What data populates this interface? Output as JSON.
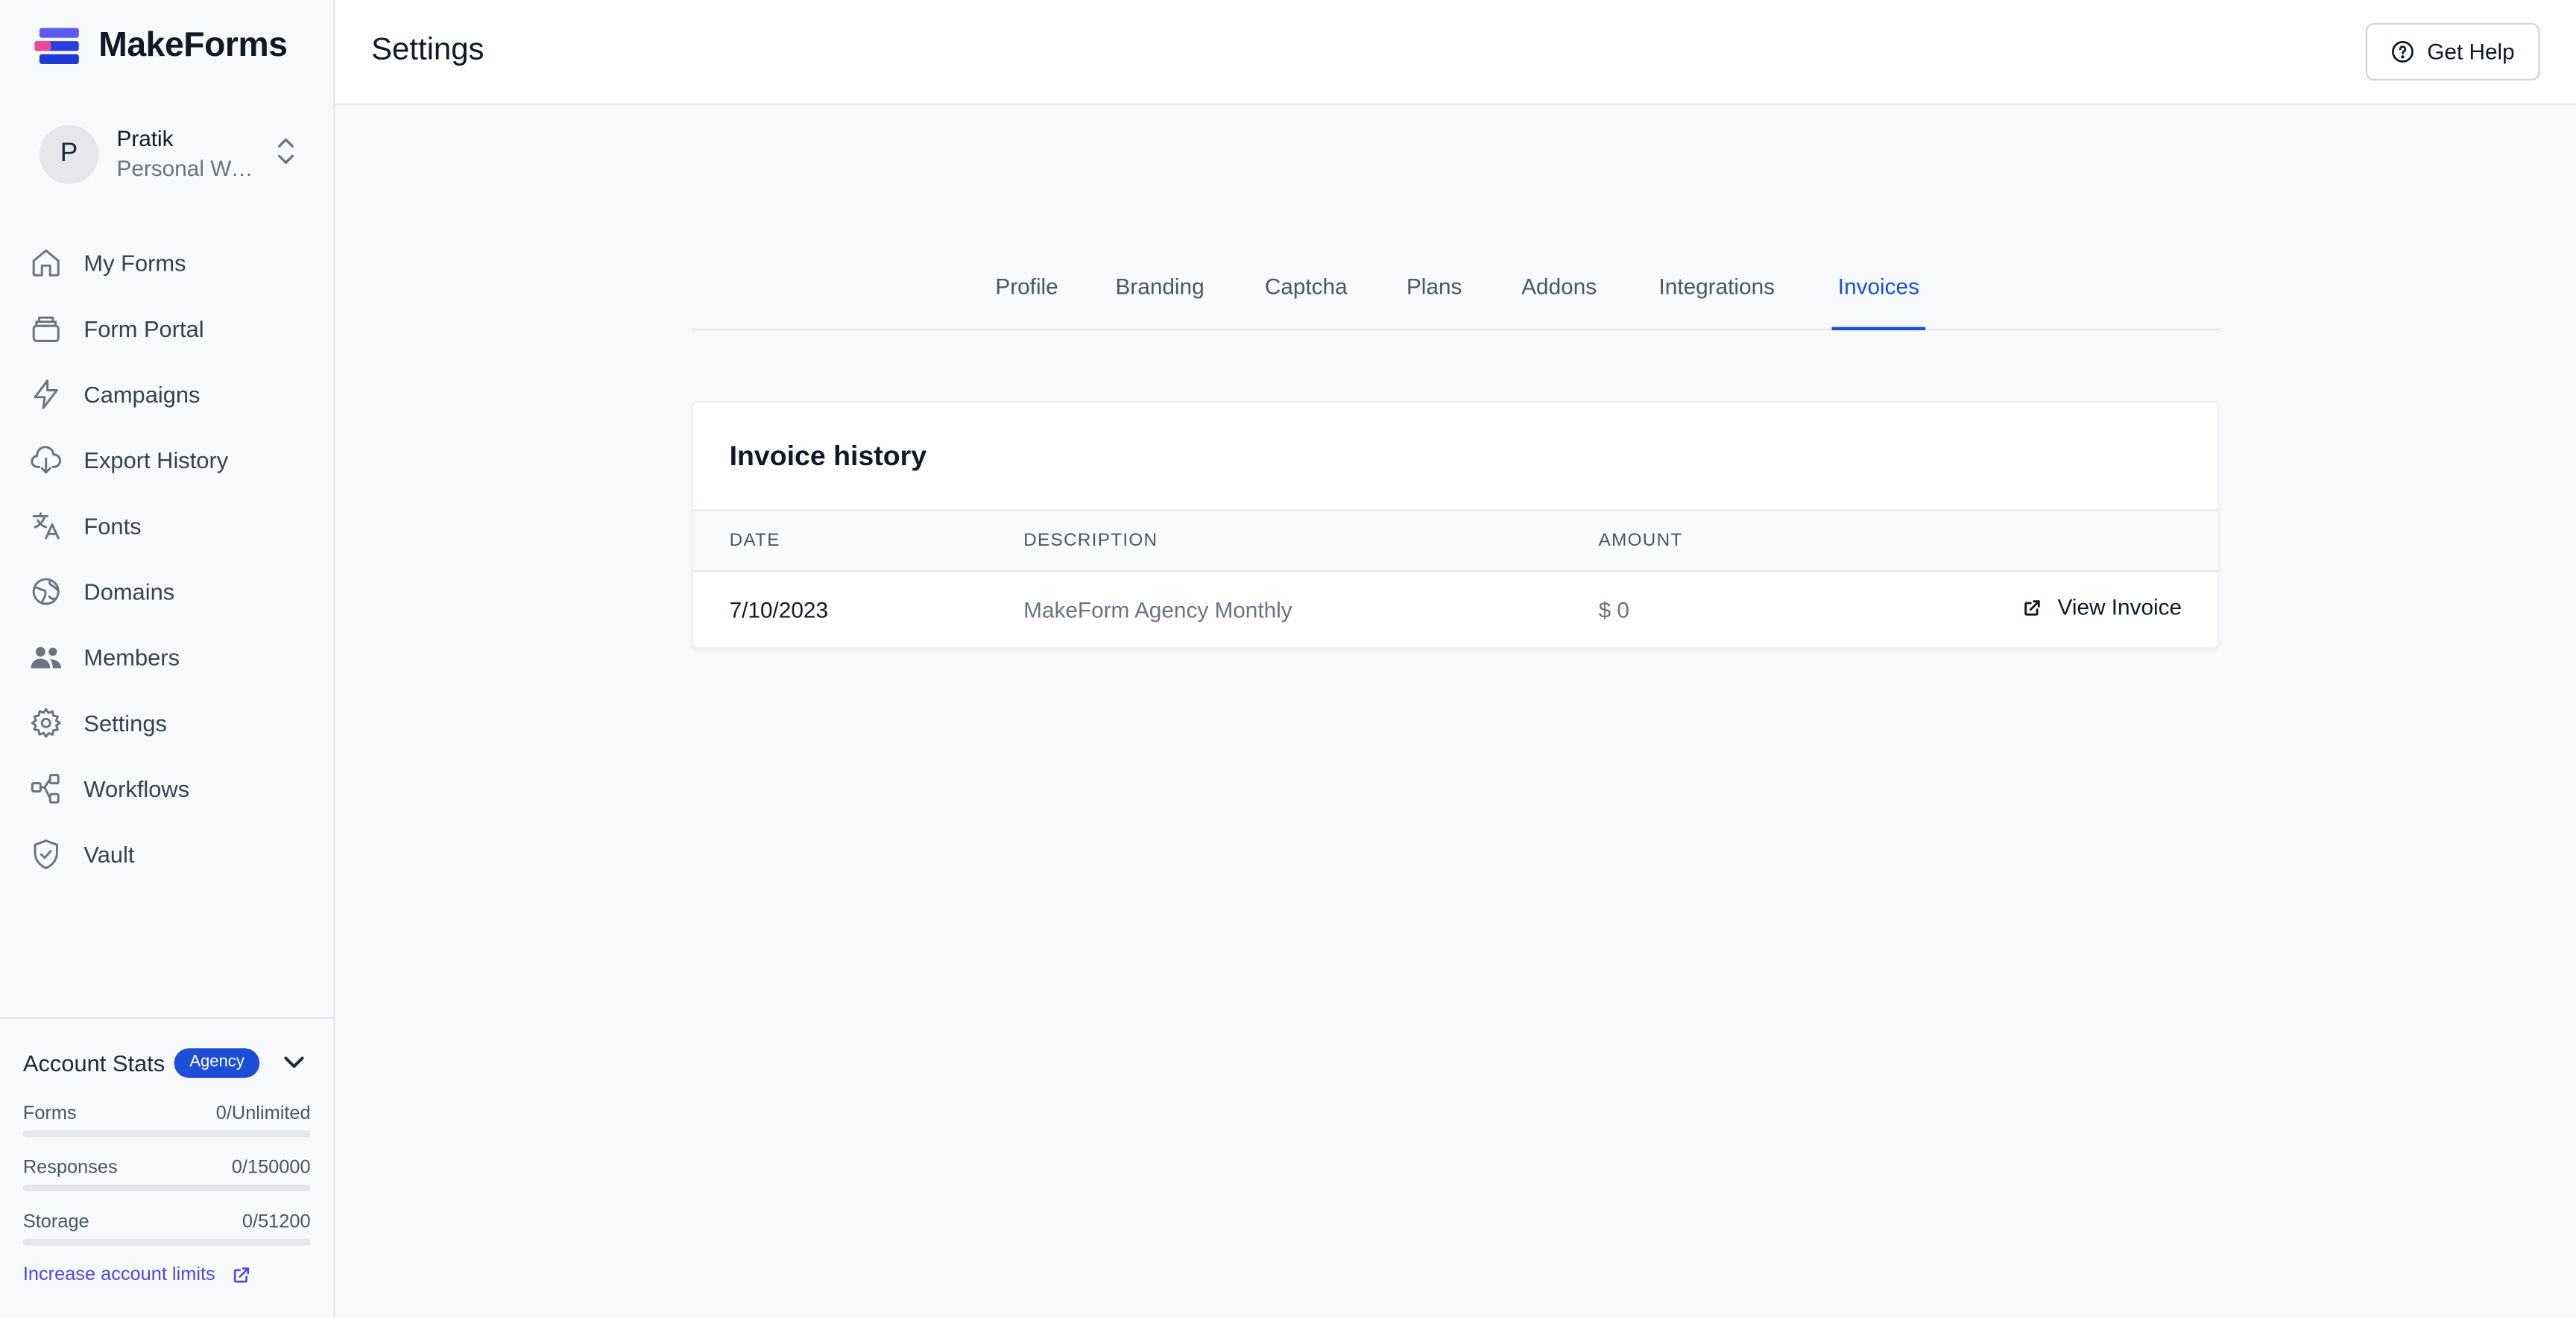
{
  "app": {
    "name": "MakeForms"
  },
  "workspace": {
    "avatar_initial": "P",
    "name": "Pratik",
    "subtitle": "Personal Workspace"
  },
  "sidebar": {
    "items": [
      {
        "label": "My Forms",
        "icon": "home-icon"
      },
      {
        "label": "Form Portal",
        "icon": "portal-icon"
      },
      {
        "label": "Campaigns",
        "icon": "lightning-icon"
      },
      {
        "label": "Export History",
        "icon": "cloud-download-icon"
      },
      {
        "label": "Fonts",
        "icon": "translate-icon"
      },
      {
        "label": "Domains",
        "icon": "globe-icon"
      },
      {
        "label": "Members",
        "icon": "users-icon"
      },
      {
        "label": "Settings",
        "icon": "gear-icon"
      },
      {
        "label": "Workflows",
        "icon": "workflow-icon"
      },
      {
        "label": "Vault",
        "icon": "shield-icon"
      }
    ]
  },
  "stats": {
    "title": "Account Stats",
    "badge": "Agency",
    "rows": [
      {
        "label": "Forms",
        "value": "0/Unlimited",
        "fill": 0
      },
      {
        "label": "Responses",
        "value": "0/150000",
        "fill": 0
      },
      {
        "label": "Storage",
        "value": "0/51200",
        "fill": 0
      }
    ],
    "link": "Increase account limits"
  },
  "header": {
    "title": "Settings",
    "help_label": "Get Help"
  },
  "tabs": [
    {
      "label": "Profile"
    },
    {
      "label": "Branding"
    },
    {
      "label": "Captcha"
    },
    {
      "label": "Plans"
    },
    {
      "label": "Addons"
    },
    {
      "label": "Integrations"
    },
    {
      "label": "Invoices",
      "active": true
    }
  ],
  "invoices": {
    "title": "Invoice history",
    "columns": [
      "DATE",
      "DESCRIPTION",
      "AMOUNT"
    ],
    "rows": [
      {
        "date": "7/10/2023",
        "description": "MakeForm Agency Monthly",
        "amount": "$ 0",
        "action": "View Invoice"
      }
    ]
  },
  "colors": {
    "accent": "#1d4ed8",
    "link": "#4f46e5"
  }
}
